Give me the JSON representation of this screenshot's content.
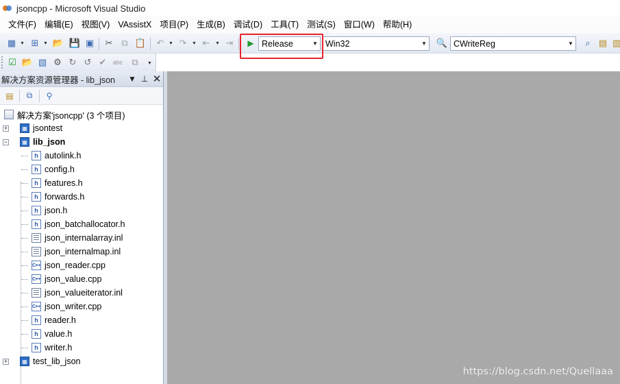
{
  "window": {
    "title": "jsoncpp - Microsoft Visual Studio"
  },
  "menu": [
    "文件(F)",
    "编辑(E)",
    "视图(V)",
    "VAssistX",
    "项目(P)",
    "生成(B)",
    "调试(D)",
    "工具(T)",
    "测试(S)",
    "窗口(W)",
    "帮助(H)"
  ],
  "toolbar": {
    "config_value": "Release",
    "platform_value": "Win32",
    "find_value": "CWriteReg",
    "accent_highlight": "#e8232b"
  },
  "solution_explorer": {
    "title": "解决方案资源管理器 - lib_json",
    "solution_label": "解决方案'jsoncpp' (3 个项目)",
    "projects": [
      {
        "name": "jsontest",
        "expanded": false
      },
      {
        "name": "lib_json",
        "expanded": true
      },
      {
        "name": "test_lib_json",
        "expanded": false
      }
    ],
    "files": [
      {
        "name": "autolink.h",
        "icon": "h"
      },
      {
        "name": "config.h",
        "icon": "h"
      },
      {
        "name": "features.h",
        "icon": "h"
      },
      {
        "name": "forwards.h",
        "icon": "h"
      },
      {
        "name": "json.h",
        "icon": "h"
      },
      {
        "name": "json_batchallocator.h",
        "icon": "h"
      },
      {
        "name": "json_internalarray.inl",
        "icon": "inl"
      },
      {
        "name": "json_internalmap.inl",
        "icon": "inl"
      },
      {
        "name": "json_reader.cpp",
        "icon": "cpp"
      },
      {
        "name": "json_value.cpp",
        "icon": "cpp"
      },
      {
        "name": "json_valueiterator.inl",
        "icon": "inl"
      },
      {
        "name": "json_writer.cpp",
        "icon": "cpp"
      },
      {
        "name": "reader.h",
        "icon": "h"
      },
      {
        "name": "value.h",
        "icon": "h"
      },
      {
        "name": "writer.h",
        "icon": "h"
      }
    ]
  },
  "watermark": "https://blog.csdn.net/Quellaaa"
}
